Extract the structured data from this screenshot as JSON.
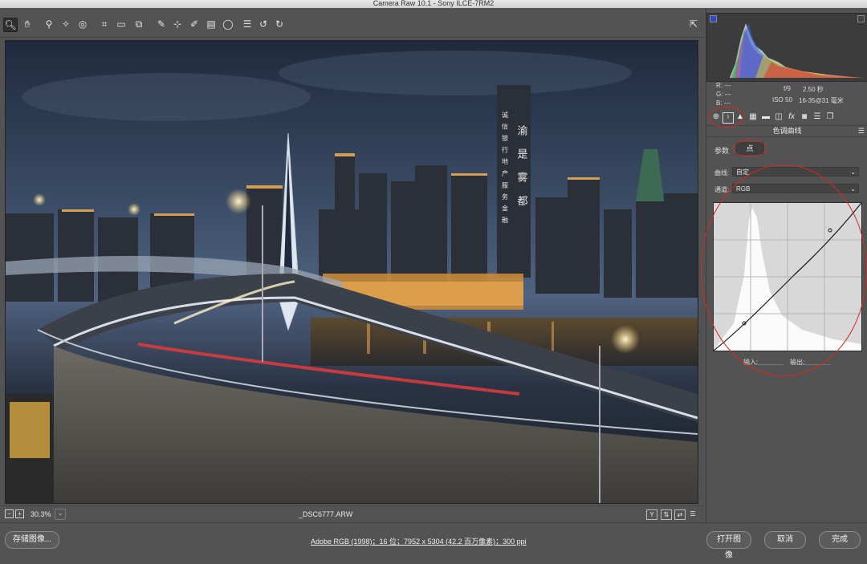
{
  "app": {
    "title": "Camera Raw 10.1 - Sony ILCE-7RM2"
  },
  "toolbar": {
    "tools": [
      {
        "icon": "zoom-icon",
        "glyph": "🔍︎",
        "active": true
      },
      {
        "icon": "hand-icon",
        "glyph": "✋︎"
      },
      {
        "icon": "white-balance-icon",
        "glyph": "⚲"
      },
      {
        "icon": "color-sampler-icon",
        "glyph": "✧"
      },
      {
        "icon": "targeted-adjustment-icon",
        "glyph": "◎"
      },
      {
        "icon": "crop-icon",
        "glyph": "⌗"
      },
      {
        "icon": "straighten-icon",
        "glyph": "▭"
      },
      {
        "icon": "transform-icon",
        "glyph": "⧉"
      },
      {
        "icon": "spot-removal-icon",
        "glyph": "✎"
      },
      {
        "icon": "red-eye-icon",
        "glyph": "⊹"
      },
      {
        "icon": "adjustment-brush-icon",
        "glyph": "✐"
      },
      {
        "icon": "graduated-filter-icon",
        "glyph": "▤"
      },
      {
        "icon": "radial-filter-icon",
        "glyph": "◯"
      },
      {
        "icon": "preferences-icon",
        "glyph": "☰"
      },
      {
        "icon": "rotate-left-icon",
        "glyph": "↺"
      },
      {
        "icon": "rotate-right-icon",
        "glyph": "↻"
      }
    ],
    "fullscreen_icon": "⇱"
  },
  "status": {
    "zoom": "30.3%",
    "filename": "_DSC6777.ARW"
  },
  "bottom": {
    "save_label": "存储图像...",
    "workflow_link": "Adobe RGB (1998)；16 位；7952 x 5304 (42.2 百万像素)；300 ppi",
    "open_label": "打开图像",
    "cancel_label": "取消",
    "done_label": "完成"
  },
  "info": {
    "r_label": "R:",
    "r_value": "---",
    "g_label": "G:",
    "g_value": "---",
    "b_label": "B:",
    "b_value": "---",
    "aperture": "f/9",
    "shutter": "2.50 秒",
    "iso": "ISO 50",
    "lens": "16-35@31 毫米"
  },
  "panel": {
    "title": "色调曲线",
    "tab_parametric": "参数",
    "tab_point": "点",
    "curve_label": "曲线:",
    "curve_value": "自定",
    "channel_label": "通道:",
    "channel_value": "RGB",
    "input_label": "输入:",
    "output_label": "输出:"
  },
  "photo_sign": {
    "col1": "渝 是 雾 都",
    "col2": "诚 信 银 行 地 产 服 务 金 融"
  },
  "colors": {
    "accent_red": "#d52a1d",
    "panel_bg": "#535353",
    "histogram_bg": "#3c3c3c"
  }
}
